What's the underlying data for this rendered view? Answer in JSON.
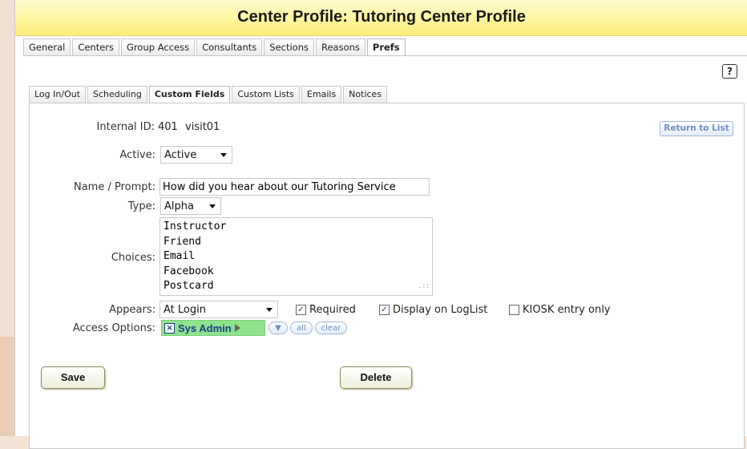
{
  "header": {
    "title": "Center Profile: Tutoring Center Profile"
  },
  "top_tabs": [
    {
      "label": "General"
    },
    {
      "label": "Centers"
    },
    {
      "label": "Group Access"
    },
    {
      "label": "Consultants"
    },
    {
      "label": "Sections"
    },
    {
      "label": "Reasons"
    },
    {
      "label": "Prefs",
      "active": true
    }
  ],
  "help": {
    "label": "?"
  },
  "sub_tabs": [
    {
      "label": "Log In/Out"
    },
    {
      "label": "Scheduling"
    },
    {
      "label": "Custom Fields",
      "active": true
    },
    {
      "label": "Custom Lists"
    },
    {
      "label": "Emails"
    },
    {
      "label": "Notices"
    }
  ],
  "form": {
    "internal_id": {
      "label": "Internal ID:",
      "id": "401",
      "code": "visit01"
    },
    "return_button": "Return to List",
    "active": {
      "label": "Active:",
      "value": "Active"
    },
    "name_prompt": {
      "label": "Name / Prompt:",
      "value": "How did you hear about our Tutoring Service"
    },
    "type": {
      "label": "Type:",
      "value": "Alpha"
    },
    "choices": {
      "label": "Choices:",
      "lines": [
        "Instructor",
        "Friend",
        "Email",
        "Facebook",
        "Postcard"
      ]
    },
    "appears": {
      "label": "Appears:",
      "value": "At Login"
    },
    "checkboxes": {
      "required": {
        "label": "Required",
        "checked": true
      },
      "display_on_loglist": {
        "label": "Display on LogList",
        "checked": true
      },
      "kiosk_entry_only": {
        "label": "KIOSK entry only",
        "checked": false
      }
    },
    "access_options": {
      "label": "Access Options:",
      "chip": "Sys Admin",
      "dropdown_glyph": "▼",
      "all_label": "all",
      "clear_label": "clear"
    }
  },
  "buttons": {
    "save": "Save",
    "delete": "Delete"
  },
  "colors": {
    "title_bar": "#fff59a",
    "chip_green": "#8fe38c",
    "link_blue": "#6e8fc2",
    "page_background": "#f3e4d6"
  },
  "icons": {
    "help": "question-mark",
    "checkbox_checked": "checkmark",
    "chip_remove": "x-box",
    "chip_more": "triangle-right",
    "select_caret": "triangle-down"
  }
}
